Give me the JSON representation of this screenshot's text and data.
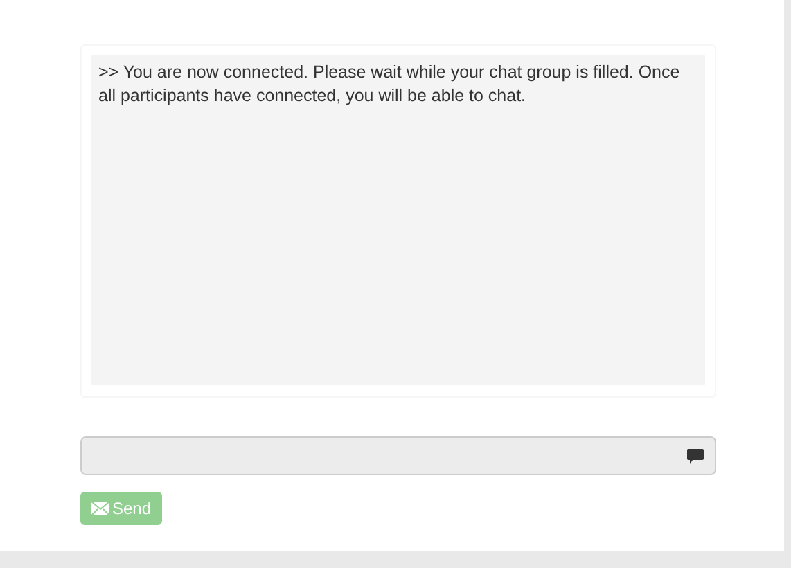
{
  "chat_log": {
    "messages": [
      ">> You are now connected. Please wait while your chat group is filled. Once all participants have connected, you will be able to chat."
    ]
  },
  "message_input": {
    "disabled": true
  },
  "send_button": {
    "label": "Send",
    "disabled": true
  }
}
